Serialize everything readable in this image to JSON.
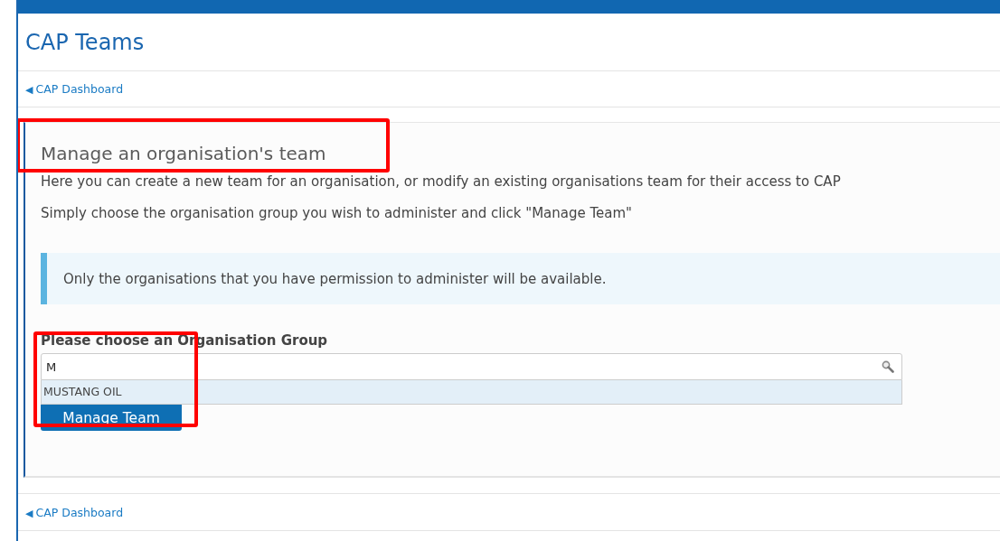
{
  "page_title": "CAP Teams",
  "breadcrumb": {
    "arrow": "◀",
    "label": "CAP Dashboard"
  },
  "panel": {
    "heading": "Manage an organisation's team",
    "paragraphs": [
      "Here you can create a new team for an organisation, or modify an existing organisations team for their access to CAP",
      "Simply choose the organisation group you wish to administer and click \"Manage Team\""
    ],
    "info": "Only the organisations that you have permission to administer will be available.",
    "field": {
      "label": "Please choose an Organisation Group",
      "value": "M"
    },
    "suggestions": [
      {
        "label": "MUSTANG OIL",
        "selected": true
      }
    ],
    "button": "Manage Team"
  },
  "footer_link": {
    "arrow": "◀",
    "label": "CAP Dashboard"
  },
  "annotations": [
    {
      "kind": "highlight"
    },
    {
      "kind": "highlight"
    }
  ]
}
